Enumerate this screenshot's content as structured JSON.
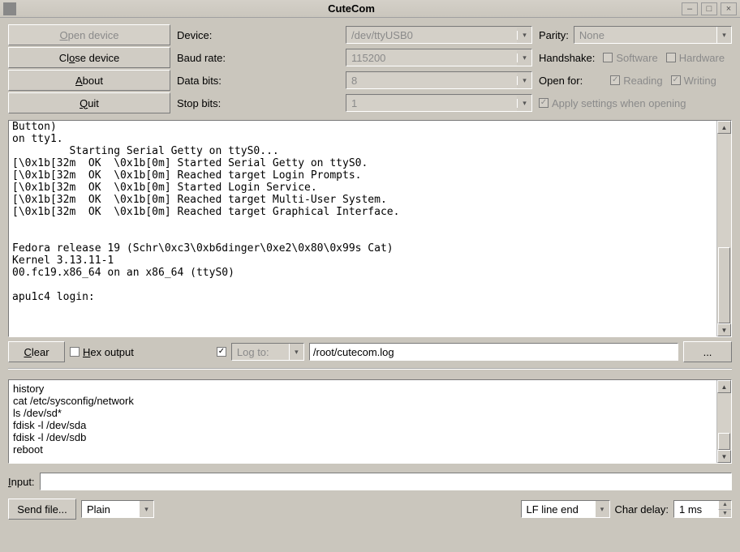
{
  "window": {
    "title": "CuteCom"
  },
  "buttons": {
    "open": "Open device",
    "close": "Close device",
    "about": "About",
    "quit": "Quit",
    "clear": "Clear",
    "sendfile": "Send file...",
    "ellipsis": "..."
  },
  "labels": {
    "device": "Device:",
    "baud": "Baud rate:",
    "databits": "Data bits:",
    "stopbits": "Stop bits:",
    "parity": "Parity:",
    "handshake": "Handshake:",
    "openfor": "Open for:",
    "input": "Input:",
    "chardelay": "Char delay:"
  },
  "combos": {
    "device": "/dev/ttyUSB0",
    "baud": "115200",
    "databits": "8",
    "stopbits": "1",
    "parity": "None",
    "logto": "Log to:",
    "lineend": "LF line end",
    "sendmode": "Plain"
  },
  "checks": {
    "software": "Software",
    "hardware": "Hardware",
    "reading": "Reading",
    "writing": "Writing",
    "apply": "Apply settings when opening",
    "hexoutput": "Hex output"
  },
  "fields": {
    "logfile": "/root/cutecom.log",
    "chardelay": "1 ms",
    "input_value": ""
  },
  "terminal": "Button)\non tty1.\n         Starting Serial Getty on ttyS0...\n[\\0x1b[32m  OK  \\0x1b[0m] Started Serial Getty on ttyS0.\n[\\0x1b[32m  OK  \\0x1b[0m] Reached target Login Prompts.\n[\\0x1b[32m  OK  \\0x1b[0m] Started Login Service.\n[\\0x1b[32m  OK  \\0x1b[0m] Reached target Multi-User System.\n[\\0x1b[32m  OK  \\0x1b[0m] Reached target Graphical Interface.\n\n\nFedora release 19 (Schr\\0xc3\\0xb6dinger\\0xe2\\0x80\\0x99s Cat)\nKernel 3.13.11-1\n00.fc19.x86_64 on an x86_64 (ttyS0)\n\napu1c4 login: ",
  "history": "history\ncat /etc/sysconfig/network\nls /dev/sd*\nfdisk -l /dev/sda\nfdisk -l /dev/sdb\nreboot"
}
